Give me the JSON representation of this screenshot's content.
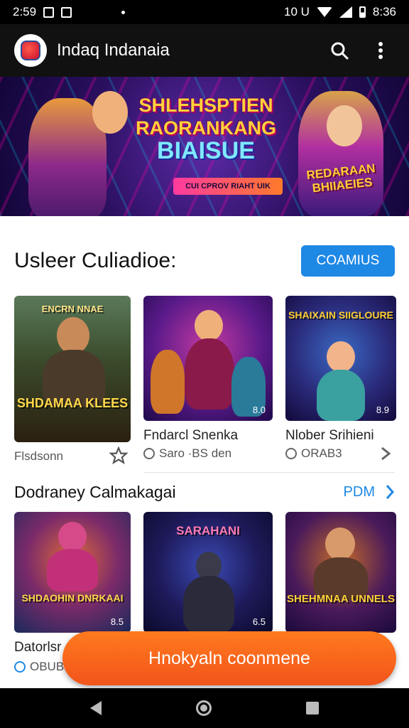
{
  "status_bar": {
    "time": "2:59",
    "clock_right": "8:36",
    "network": "10 U"
  },
  "app_bar": {
    "title": "Indaq Indanaia",
    "icons": [
      "search-icon",
      "more-vert-icon"
    ]
  },
  "banner": {
    "title_lines": [
      "SHLEHSPTIEN",
      "RAORANKANG",
      "BIAISUE"
    ],
    "strip_text": "CUI CPROV RIAHT UIK",
    "badge_text": "REDARAAN BHIIAEIES"
  },
  "section1": {
    "title": "Usleer Culiadioe:",
    "button": "COAMIUS",
    "cards": [
      {
        "thumb_title": "SHDAMAA KLEES",
        "thumb_top": "ENCRN NNAE",
        "title": "",
        "meta": "Flsdsonn",
        "icon": "star-outline-icon"
      },
      {
        "thumb_title": "",
        "count": "8.0",
        "title": "Fndarcl Snenka",
        "meta": "Saro ·BS den",
        "icon": ""
      },
      {
        "thumb_title": "SHAIXAIN SIIGLOURE",
        "count": "8.9",
        "title": "Nlober Srihieni",
        "meta": "ORAB3",
        "icon": "chevron-right-icon"
      }
    ]
  },
  "section2": {
    "title": "Dodraney Calmakagai",
    "link": "PDM",
    "cards": [
      {
        "thumb_title": "SHDAOHIN DNRKAAI",
        "count": "8.5",
        "title": "Datorlsr",
        "meta": "OBUBI"
      },
      {
        "thumb_title": "SARAHANI",
        "count": "6.5"
      },
      {
        "thumb_title": "SHEHMNAA UNNELS",
        "count": ""
      }
    ]
  },
  "fab": {
    "label": "Hnokyaln coonmene"
  },
  "colors": {
    "accent": "#1e88e5",
    "fab": "#f2541b",
    "appbar": "#111111"
  }
}
